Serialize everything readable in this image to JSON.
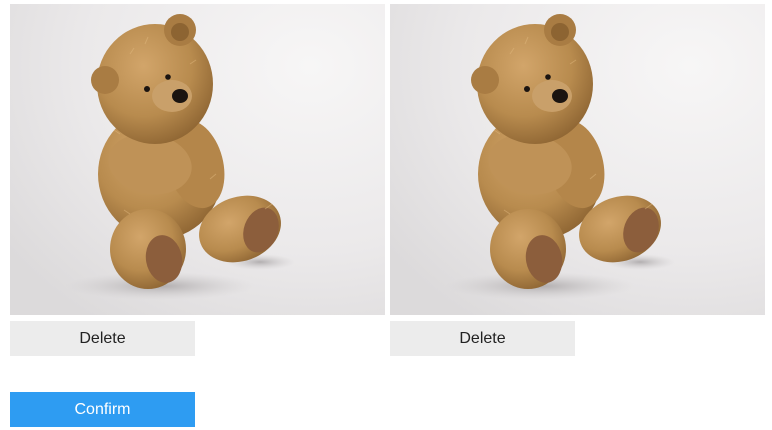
{
  "images": [
    {
      "subject": "teddy bear photo",
      "delete_label": "Delete"
    },
    {
      "subject": "teddy bear photo",
      "delete_label": "Delete"
    }
  ],
  "confirm_label": "Confirm",
  "colors": {
    "confirm_bg": "#2e9cf2",
    "delete_bg": "#ececec",
    "fur": "#b88b4e",
    "fur_dark": "#8d6432",
    "paw_pad": "#8c5e3c"
  }
}
